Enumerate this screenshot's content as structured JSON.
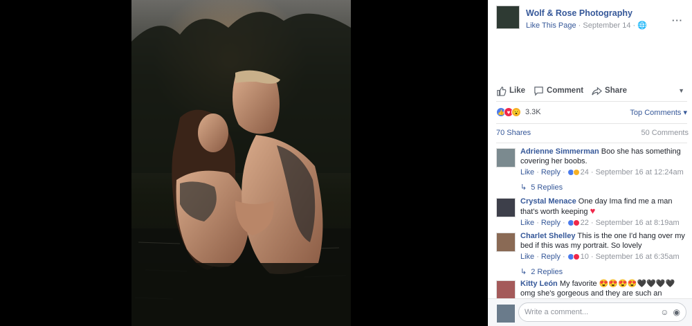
{
  "post": {
    "page_name": "Wolf & Rose Photography",
    "like_page": "Like This Page",
    "date": "September 14",
    "separator": "·",
    "more": "···"
  },
  "actions": {
    "like": "Like",
    "comment": "Comment",
    "share": "Share"
  },
  "reactions": {
    "count": "3.3K",
    "top_comments": "Top Comments"
  },
  "stats": {
    "shares": "70 Shares",
    "comments": "50 Comments"
  },
  "comments": [
    {
      "author": "Adrienne Simmerman",
      "text": "Boo she has something covering her boobs.",
      "like": "Like",
      "reply": "Reply",
      "reactions": "24",
      "time": "September 16 at 12:24am",
      "replies": "5 Replies"
    },
    {
      "author": "Crystal Menace",
      "text": "One day Ima find me a man that's worth keeping",
      "like": "Like",
      "reply": "Reply",
      "reactions": "22",
      "time": "September 16 at 8:19am"
    },
    {
      "author": "Charlet Shelley",
      "text": "This is the one I'd hang over my bed if this was my portrait. So lovely",
      "like": "Like",
      "reply": "Reply",
      "reactions": "10",
      "time": "September 16 at 6:35am",
      "replies": "2 Replies"
    },
    {
      "author": "Kitty León",
      "text": "My favorite 😍😍😍😍🖤🖤🖤🖤 omg she's gorgeous and they are such an"
    }
  ],
  "composer": {
    "placeholder": "Write a comment..."
  },
  "colors": {
    "link": "#365899",
    "like_blue": "#4b7bec",
    "love_red": "#f0284a"
  }
}
